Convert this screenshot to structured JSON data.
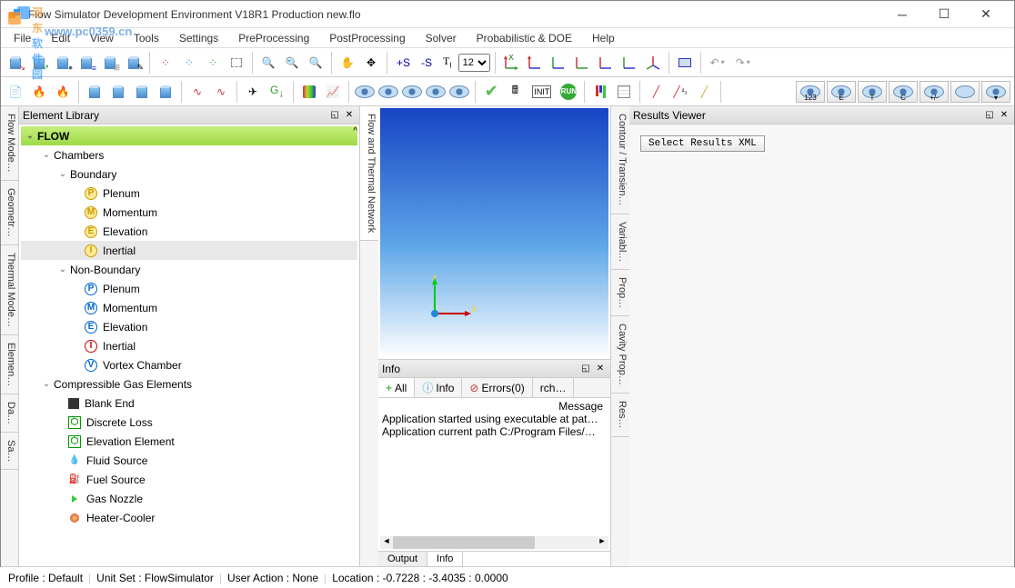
{
  "window": {
    "title": "Flow Simulator Development Environment V18R1 Production new.flo"
  },
  "menu": [
    "File",
    "Edit",
    "View",
    "Tools",
    "Settings",
    "PreProcessing",
    "PostProcessing",
    "Solver",
    "Probabilistic & DOE",
    "Help"
  ],
  "watermark": {
    "text1_a": "河东",
    "text1_b": "软件园",
    "text2": "www.pc0359.cn"
  },
  "fontsize": "12",
  "leftTabs": [
    "Flow Mode…",
    "Geometr…",
    "Thermal Mode…",
    "Elemen…",
    "Da…",
    "Sa…"
  ],
  "elementLibrary": {
    "title": "Element Library",
    "tree": {
      "root": "FLOW",
      "chambers": "Chambers",
      "boundary": "Boundary",
      "b_plenum": "Plenum",
      "b_momentum": "Momentum",
      "b_elevation": "Elevation",
      "b_inertial": "Inertial",
      "nonboundary": "Non-Boundary",
      "nb_plenum": "Plenum",
      "nb_momentum": "Momentum",
      "nb_elevation": "Elevation",
      "nb_inertial": "Inertial",
      "nb_vortex": "Vortex Chamber",
      "cge": "Compressible Gas Elements",
      "blank": "Blank End",
      "discrete": "Discrete Loss",
      "elev_elem": "Elevation Element",
      "fluid": "Fluid Source",
      "fuel": "Fuel Source",
      "gas": "Gas Nozzle",
      "heater": "Heater-Cooler"
    }
  },
  "centerTab": "Flow and Thermal Network",
  "axis": {
    "x": "x",
    "y": "y"
  },
  "info": {
    "title": "Info",
    "tabs": {
      "all": "All",
      "info": "Info",
      "errors": "Errors(0)",
      "rch": "rch…"
    },
    "col": "Message",
    "lines": [
      "Application started using executable at pat…",
      "Application current  path C:/Program Files/…"
    ],
    "bottomTabs": {
      "output": "Output",
      "info": "Info"
    }
  },
  "rightTabs": [
    "Contour / Transien…",
    "Variabl…",
    "Prop…",
    "Cavity Prop…",
    "Res…"
  ],
  "results": {
    "title": "Results Viewer",
    "btn": "Select Results XML"
  },
  "statusbar": {
    "profile": "Profile : Default",
    "unitset": "Unit Set :  FlowSimulator",
    "useraction": "User Action :  None",
    "location": "Location :  -0.7228  :  -3.4035  :  0.0000"
  },
  "eyebar": [
    "123",
    "E",
    "T",
    "C",
    "+/-"
  ]
}
